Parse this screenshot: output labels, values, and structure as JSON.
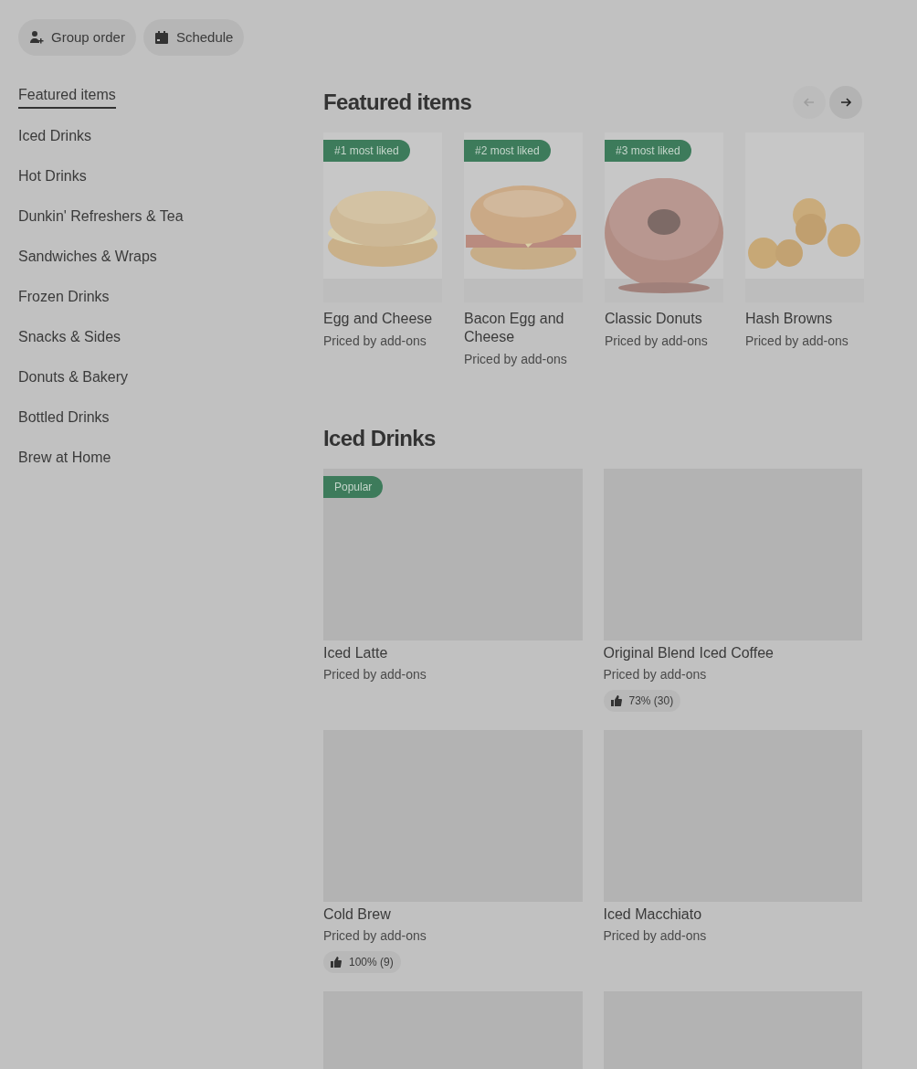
{
  "top_buttons": [
    {
      "kind": "group",
      "label": "Group order"
    },
    {
      "kind": "schedule",
      "label": "Schedule"
    }
  ],
  "sidebar": {
    "items": [
      {
        "label": "Featured items",
        "selected": true
      },
      {
        "label": "Iced Drinks",
        "selected": false
      },
      {
        "label": "Hot Drinks",
        "selected": false
      },
      {
        "label": "Dunkin' Refreshers & Tea",
        "selected": false
      },
      {
        "label": "Sandwiches & Wraps",
        "selected": false
      },
      {
        "label": "Frozen Drinks",
        "selected": false
      },
      {
        "label": "Snacks & Sides",
        "selected": false
      },
      {
        "label": "Donuts & Bakery",
        "selected": false
      },
      {
        "label": "Bottled Drinks",
        "selected": false
      },
      {
        "label": "Brew at Home",
        "selected": false
      }
    ]
  },
  "featured": {
    "title": "Featured items",
    "prev": {
      "disabled": true
    },
    "next": {
      "disabled": false
    },
    "items": [
      {
        "badge": "#1 most liked",
        "name": "Egg and Cheese",
        "price": "Priced by add-ons"
      },
      {
        "badge": "#2 most liked",
        "name": "Bacon Egg and Cheese",
        "price": "Priced by add-ons"
      },
      {
        "badge": "#3 most liked",
        "name": "Classic Donuts",
        "price": "Priced by add-ons"
      },
      {
        "name": "Hash Browns",
        "price": "Priced by add-ons"
      }
    ]
  },
  "iced_drinks": {
    "title": "Iced Drinks",
    "items": [
      {
        "kind": "item",
        "badge": "Popular",
        "name": "Iced Latte",
        "price": "Priced by add-ons"
      },
      {
        "kind": "item",
        "name": "Original Blend Iced Coffee",
        "price": "Priced by add-ons",
        "rating": "73% (30)"
      },
      {
        "kind": "item",
        "name": "Cold Brew",
        "price": "Priced by add-ons",
        "rating": "100% (9)"
      },
      {
        "kind": "item",
        "name": "Iced Macchiato",
        "price": "Priced by add-ons"
      },
      {
        "kind": "image_only"
      },
      {
        "kind": "image_only"
      }
    ]
  }
}
